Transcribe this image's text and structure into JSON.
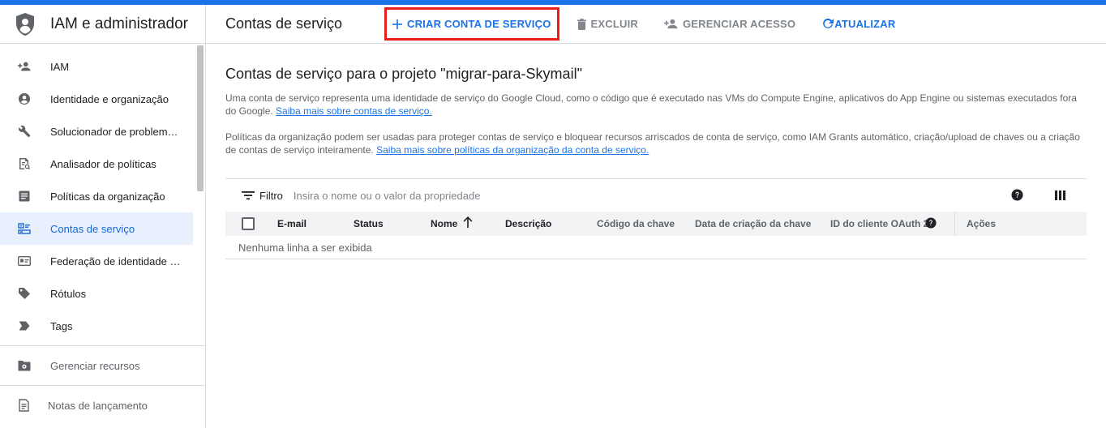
{
  "app": {
    "title": "IAM e administrador"
  },
  "sidebar": {
    "items": [
      {
        "label": "IAM",
        "icon": "person-add-icon"
      },
      {
        "label": "Identidade e organização",
        "icon": "account-circle-icon"
      },
      {
        "label": "Solucionador de problem…",
        "icon": "wrench-icon"
      },
      {
        "label": "Analisador de políticas",
        "icon": "policy-doc-icon"
      },
      {
        "label": "Políticas da organização",
        "icon": "list-doc-icon"
      },
      {
        "label": "Contas de serviço",
        "icon": "service-account-icon",
        "active": true
      },
      {
        "label": "Federação de identidade …",
        "icon": "id-card-icon"
      },
      {
        "label": "Rótulos",
        "icon": "label-tag-icon"
      },
      {
        "label": "Tags",
        "icon": "tag-arrow-icon"
      }
    ],
    "manage_resources": "Gerenciar recursos",
    "release_notes": "Notas de lançamento"
  },
  "header": {
    "title": "Contas de serviço",
    "create_label": "CRIAR CONTA DE SERVIÇO",
    "delete_label": "EXCLUIR",
    "manage_access_label": "GERENCIAR ACESSO",
    "refresh_label": "ATUALIZAR"
  },
  "main": {
    "title": "Contas de serviço para o projeto \"migrar-para-Skymail\"",
    "desc1_text": "Uma conta de serviço representa uma identidade de serviço do Google Cloud, como o código que é executado nas VMs do Compute Engine, aplicativos do App Engine ou sistemas executados fora do Google. ",
    "desc1_link": "Saiba mais sobre contas de serviço.",
    "desc2_text": "Políticas da organização podem ser usadas para proteger contas de serviço e bloquear recursos arriscados de conta de serviço, como IAM Grants automático, criação/upload de chaves ou a criação de contas de serviço inteiramente. ",
    "desc2_link": "Saiba mais sobre políticas da organização da conta de serviço."
  },
  "table": {
    "filter_label": "Filtro",
    "filter_placeholder": "Insira o nome ou o valor da propriedade",
    "columns": {
      "email": "E-mail",
      "status": "Status",
      "name": "Nome",
      "description": "Descrição",
      "key_id": "Código da chave",
      "key_created": "Data de criação da chave",
      "oauth_id": "ID do cliente OAuth 2",
      "actions": "Ações"
    },
    "empty_message": "Nenhuma linha a ser exibida"
  },
  "colors": {
    "accent": "#1a73e8",
    "highlight_border": "#ea1c1c",
    "active_bg": "#e8f0fe"
  }
}
